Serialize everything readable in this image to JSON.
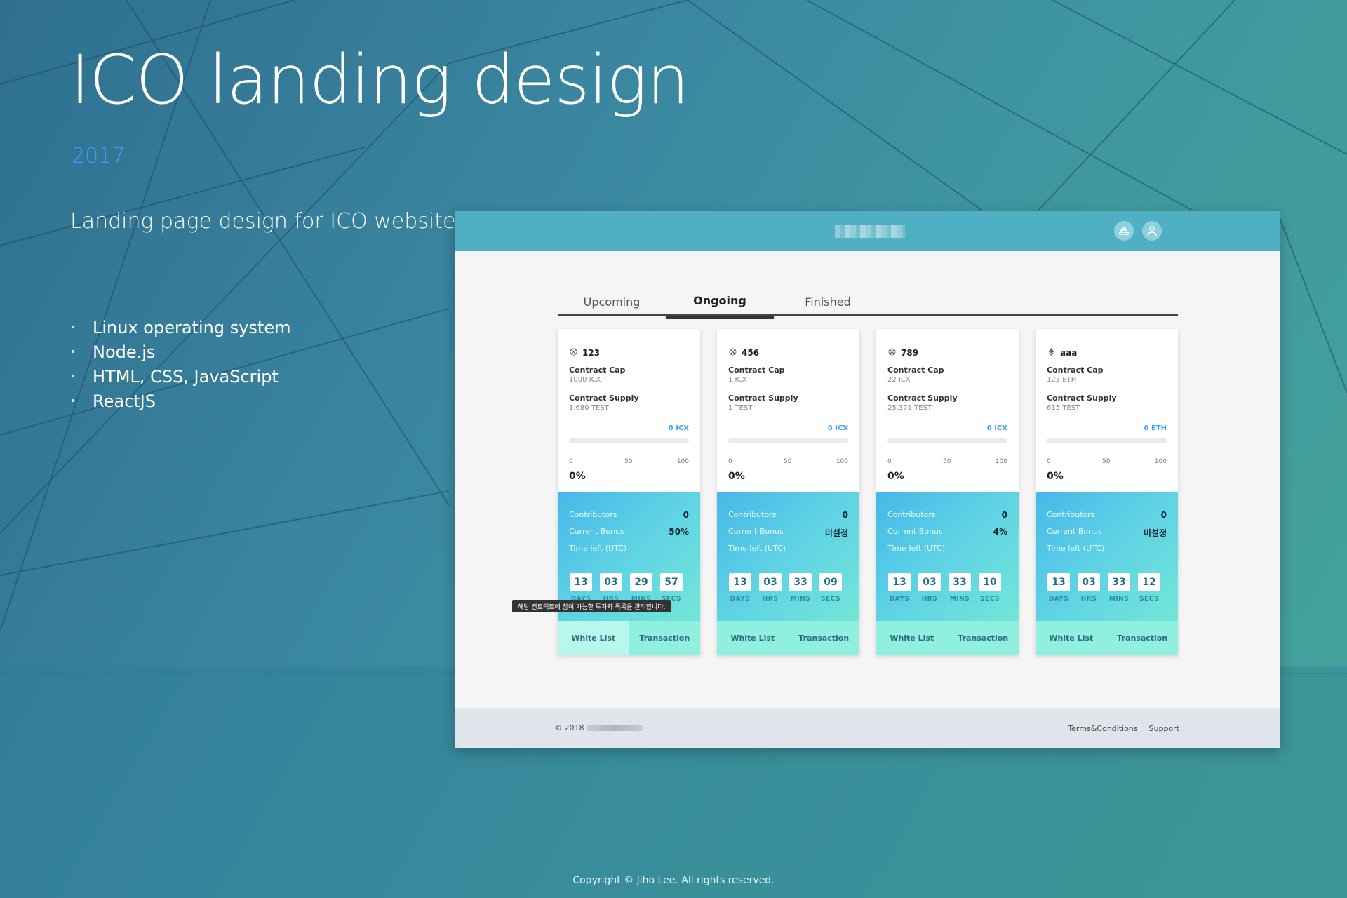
{
  "hero": {
    "title": "ICO landing design",
    "year": "2017",
    "description": "Landing page design for ICO website.",
    "tech": [
      "Linux operating system",
      "Node.js",
      "HTML, CSS, JavaScript",
      "ReactJS"
    ]
  },
  "copyright": "Copyright © Jiho Lee. All rights reserved.",
  "mock": {
    "header": {
      "accent": "#4fb0c4",
      "icons": [
        "wallet-icon",
        "user-icon"
      ]
    },
    "tabs": [
      "Upcoming",
      "Ongoing",
      "Finished"
    ],
    "active_tab": "Ongoing",
    "labels": {
      "contract_cap": "Contract Cap",
      "contract_supply": "Contract Supply",
      "contributors": "Contributors",
      "current_bonus": "Current Bonus",
      "time_left": "Time left (UTC)",
      "days": "DAYS",
      "hrs": "HRS",
      "mins": "MINS",
      "secs": "SECS",
      "white_list": "White List",
      "transaction": "Transaction",
      "tick_0": "0",
      "tick_50": "50",
      "tick_100": "100"
    },
    "cards": [
      {
        "coin_icon": "icx-icon",
        "name": "123",
        "cap": "1000 ICX",
        "supply": "1,680 TEST",
        "raised": "0 ICX",
        "progress": 0,
        "percent": "0%",
        "contributors": "0",
        "bonus": "50%",
        "days": "13",
        "hrs": "03",
        "mins": "29",
        "secs": "57"
      },
      {
        "coin_icon": "icx-icon",
        "name": "456",
        "cap": "1 ICX",
        "supply": "1 TEST",
        "raised": "0 ICX",
        "progress": 0,
        "percent": "0%",
        "contributors": "0",
        "bonus": "미설정",
        "days": "13",
        "hrs": "03",
        "mins": "33",
        "secs": "09"
      },
      {
        "coin_icon": "icx-icon",
        "name": "789",
        "cap": "22 ICX",
        "supply": "25,371 TEST",
        "raised": "0 ICX",
        "progress": 0,
        "percent": "0%",
        "contributors": "0",
        "bonus": "4%",
        "days": "13",
        "hrs": "03",
        "mins": "33",
        "secs": "10"
      },
      {
        "coin_icon": "eth-icon",
        "name": "aaa",
        "cap": "123 ETH",
        "supply": "615 TEST",
        "raised": "0 ETH",
        "progress": 0,
        "percent": "0%",
        "contributors": "0",
        "bonus": "미설정",
        "days": "13",
        "hrs": "03",
        "mins": "33",
        "secs": "12"
      }
    ],
    "tooltip": "해당 컨트랙트에 참여 가능한 투자자 목록을 관리합니다.",
    "footer": {
      "copy": "© 2018",
      "links": [
        "Terms&Conditions",
        "Support"
      ]
    }
  }
}
